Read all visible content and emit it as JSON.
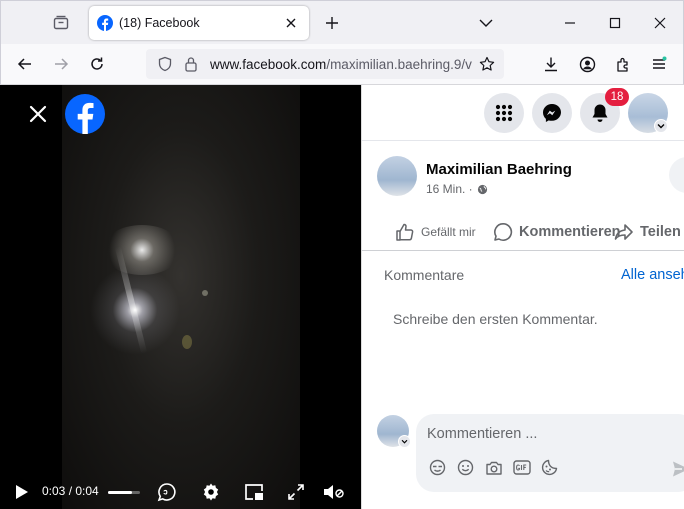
{
  "browser": {
    "tab": {
      "title": "(18) Facebook"
    },
    "url": {
      "host": "www.facebook.com",
      "path": "/maximilian.baehring.9/v"
    }
  },
  "viewer": {
    "time_label": "0:03 / 0:04",
    "progress": 0.75
  },
  "header": {
    "notification_count": "18"
  },
  "post": {
    "author": "Maximilian Baehring",
    "time": "16 Min. ·",
    "actions": {
      "like": "Gefällt mir",
      "comment": "Kommentieren",
      "share": "Teilen"
    }
  },
  "comments": {
    "header": "Kommentare",
    "all_link": "Alle ansehen",
    "empty_prompt": "Schreibe den ersten Kommentar.",
    "placeholder": "Kommentieren ..."
  },
  "colors": {
    "facebook_blue": "#0866ff",
    "badge_red": "#e41e3f",
    "link_blue": "#0064d1"
  }
}
